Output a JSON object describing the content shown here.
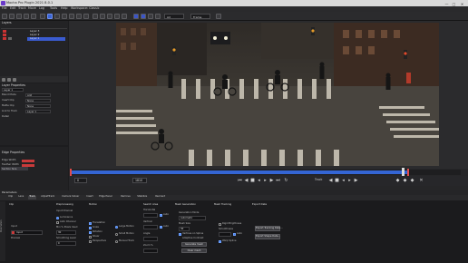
{
  "window": {
    "title": "Mocha Pro Plugin 2021 8.0.1",
    "controls": [
      "—",
      "□",
      "✕"
    ]
  },
  "menu": [
    "File",
    "Edit",
    "Track",
    "Move",
    "Log",
    "Tools",
    "Help",
    "Workspace: Classic"
  ],
  "toolbar": {
    "view_dropdown": "Ad",
    "layer_dropdown": "Frame"
  },
  "layers_panel": {
    "title": "Layers",
    "items": [
      "Layer 3",
      "Layer 2",
      "Layer 1"
    ],
    "selected": 2
  },
  "layer_properties": {
    "title": "Layer Properties",
    "rows": [
      {
        "label": "Layer",
        "value": "Layer 1"
      },
      {
        "label": "Blend Mode",
        "value": "Add"
      },
      {
        "label": "Insert Clip",
        "value": "None"
      },
      {
        "label": "Matte Clip",
        "value": "None"
      },
      {
        "label": "Link to Track",
        "value": "Layer 1"
      },
      {
        "label": "Detail",
        "value": ""
      }
    ]
  },
  "edge_properties": {
    "title": "Edge Properties",
    "rows": [
      "Edge Width",
      "Feather Width",
      "Section Size"
    ]
  },
  "transport": {
    "current_frame": "0",
    "end_frame": "1810",
    "track_label": "Track"
  },
  "parameters": {
    "title": "Parameters",
    "tabs": [
      "Clip",
      "Lens",
      "Track",
      "AdjustTrack",
      "Camera Solver",
      "Insert",
      "Edge Panel",
      "Remove",
      "Stabilize",
      "Reorient"
    ],
    "active_tab": 2,
    "side_tab": "Parameters",
    "clip": {
      "title": "Clip",
      "input_label": "Input",
      "input_value": "Input",
      "preview_label": "Preview"
    },
    "preprocessing": {
      "title": "Preprocessing",
      "input_channel": "Input Channel",
      "luminance": "Luminance",
      "auto_channel": "Auto Channel",
      "min_pixels_used": "Min % Pixels Used",
      "min_value": "30",
      "smoothing_level": "Smoothing Level",
      "smoothing_value": "0"
    },
    "motion": {
      "title": "Motion",
      "options": [
        "Translation",
        "Scale",
        "Rotation",
        "Shear",
        "Perspective"
      ],
      "large_motion": "Large Motion",
      "small_motion": "Small Motion",
      "manual_track": "Manual Track"
    },
    "search_area": {
      "title": "Search Area",
      "horizontal": "Horizontal",
      "vertical": "Vertical",
      "angle": "Angle",
      "zoom": "Zoom %",
      "auto": "Auto"
    },
    "mesh_generation": {
      "title": "Mesh Generation",
      "generation_mode": "Generation Mode",
      "mode_value": "Automatic",
      "mesh_size": "Mesh Size",
      "mesh_size_value": "30",
      "vertices_on_spline": "Vertices on Spline",
      "adaptive_contrast": "Adaptive Contrast",
      "generate_mesh": "Generate mesh",
      "clear_mesh": "Clear mesh"
    },
    "mesh_tracking": {
      "title": "Mesh Tracking",
      "rigid_brightness": "Rigid Brightness",
      "smoothness": "Smoothness",
      "auto": "Auto",
      "warp_spline": "Warp Spline"
    },
    "export_data": {
      "title": "Export Data",
      "export_tracking": "Export Tracking Data...",
      "export_shape": "Export Shape Data..."
    }
  },
  "colors": {
    "accent": "#3b66d6",
    "timeline": "#3465d4",
    "brand": "#6a39c9"
  }
}
